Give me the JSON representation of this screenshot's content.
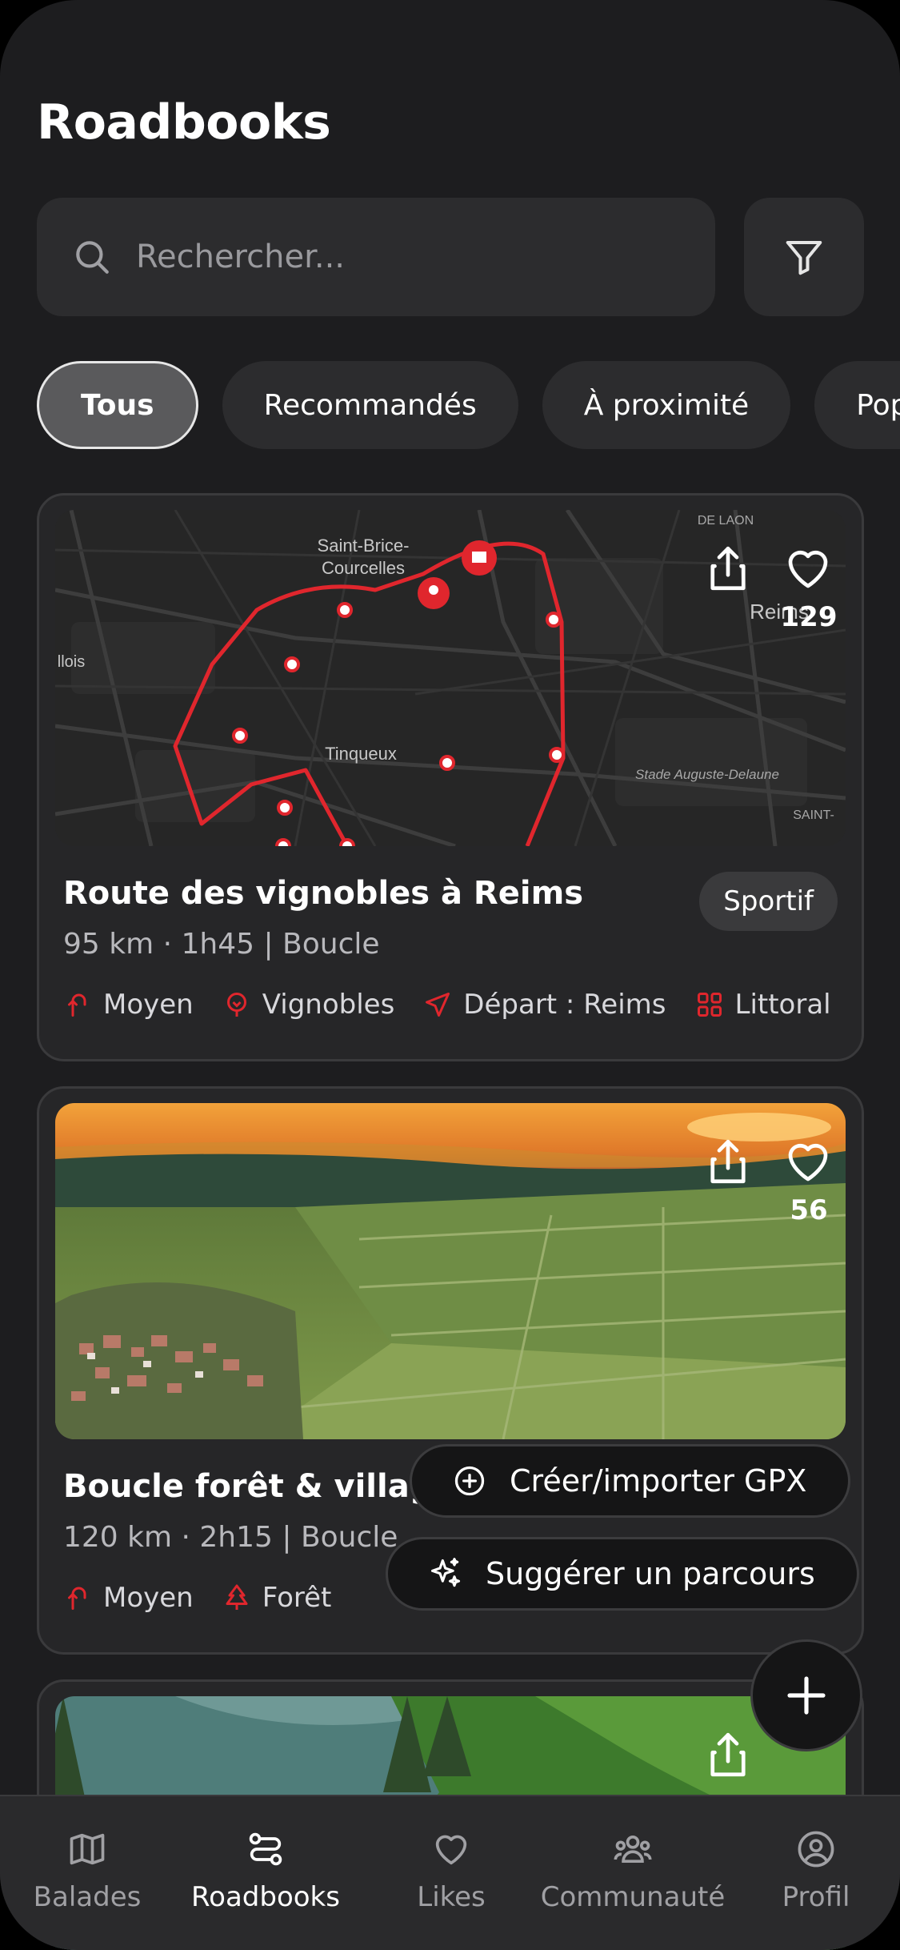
{
  "header": {
    "title": "Roadbooks"
  },
  "search": {
    "placeholder": "Rechercher..."
  },
  "chips": [
    {
      "label": "Tous",
      "active": true
    },
    {
      "label": "Recommandés",
      "active": false
    },
    {
      "label": "À proximité",
      "active": false
    },
    {
      "label": "Pop",
      "active": false
    }
  ],
  "cards": [
    {
      "title": "Route des vignobles à Reims",
      "subtitle": "95 km · 1h45 | Boucle",
      "badge": "Sportif",
      "likes": "129",
      "map_labels": [
        "Saint-Brice-",
        "Courcelles",
        "Tinqueux",
        "Reims",
        "llois",
        "Stade Auguste-Delaune",
        "DE LAON",
        "SAINT-"
      ],
      "tags": [
        {
          "icon": "difficulty-icon",
          "label": "Moyen"
        },
        {
          "icon": "grape-icon",
          "label": "Vignobles"
        },
        {
          "icon": "navigation-icon",
          "label": "Départ : Reims"
        },
        {
          "icon": "grid-icon",
          "label": "Littoral"
        }
      ]
    },
    {
      "title": "Boucle forêt & villages",
      "subtitle": "120 km · 2h15 | Boucle",
      "likes": "56",
      "tags": [
        {
          "icon": "difficulty-icon",
          "label": "Moyen"
        },
        {
          "icon": "tree-icon",
          "label": "Forêt"
        }
      ]
    }
  ],
  "actions": {
    "create_gpx": "Créer/importer GPX",
    "suggest_route": "Suggérer un parcours"
  },
  "tabbar": [
    {
      "label": "Balades",
      "active": false
    },
    {
      "label": "Roadbooks",
      "active": true
    },
    {
      "label": "Likes",
      "active": false
    },
    {
      "label": "Communauté",
      "active": false
    },
    {
      "label": "Profil",
      "active": false
    }
  ],
  "colors": {
    "accent": "#e0262d",
    "background": "#1d1d1f",
    "surface": "#2c2c2e"
  }
}
